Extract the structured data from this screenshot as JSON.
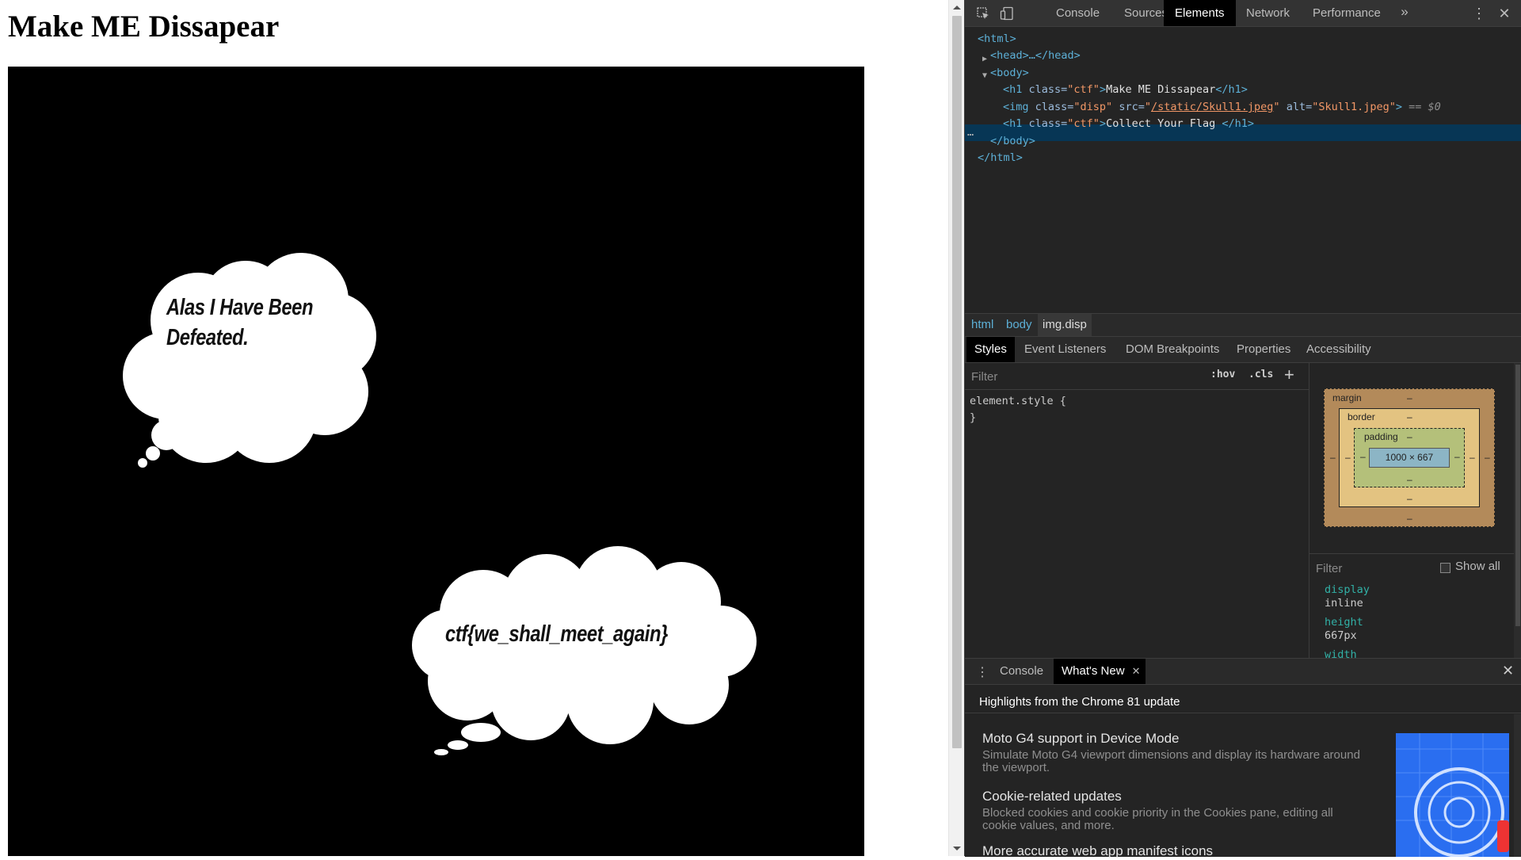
{
  "page": {
    "heading": "Make ME Dissapear",
    "bubble1_line1": "Alas I Have Been",
    "bubble1_line2": "Defeated.",
    "bubble2_text": "ctf{we_shall_meet_again}"
  },
  "devtools": {
    "tabs": [
      "Console",
      "Sources",
      "Elements",
      "Network",
      "Performance"
    ],
    "active_tab": "Elements",
    "more_tabs": "»",
    "dom": {
      "html_open": "<html>",
      "head": "<head>…</head>",
      "body_open": "<body>",
      "h1_tag_open": "<h1 ",
      "h1_attr": "class=",
      "h1_attr_val": "\"ctf\"",
      "h1_text": "Make ME Dissapear",
      "h1_close": "</h1>",
      "img_open": "<img ",
      "img_class_attr": "class=",
      "img_class_val": "\"disp\"",
      "img_src_attr": " src=",
      "img_src_q1": "\"",
      "img_src_val": "/static/Skull1.jpeg",
      "img_src_q2": "\"",
      "img_alt_attr": " alt=",
      "img_alt_val": "\"Skull1.jpeg\"",
      "img_close": ">",
      "img_eq": " == $0",
      "h1b_text": "Collect Your Flag ",
      "body_close": "</body>",
      "html_close": "</html>",
      "dots": "…"
    },
    "breadcrumbs": [
      "html",
      "body",
      "img.disp"
    ],
    "subtabs": [
      "Styles",
      "Event Listeners",
      "DOM Breakpoints",
      "Properties",
      "Accessibility"
    ],
    "styles": {
      "filter_placeholder": "Filter",
      "hov": ":hov",
      "cls": ".cls",
      "add": "+",
      "rule": "element.style {\n}"
    },
    "box_model": {
      "margin_label": "margin",
      "border_label": "border",
      "padding_label": "padding",
      "content_size": "1000 × 667",
      "dash": "–"
    },
    "computed": {
      "filter_placeholder": "Filter",
      "show_all": "Show all",
      "props": [
        {
          "name": "display",
          "value": "inline"
        },
        {
          "name": "height",
          "value": "667px"
        },
        {
          "name": "width",
          "value": ""
        }
      ]
    },
    "drawer": {
      "tabs": [
        "Console",
        "What's New"
      ],
      "active_tab": "What's New",
      "title": "Highlights from the Chrome 81 update",
      "items": [
        {
          "head": "Moto G4 support in Device Mode",
          "body": "Simulate Moto G4 viewport dimensions and display its hardware around the viewport."
        },
        {
          "head": "Cookie-related updates",
          "body": "Blocked cookies and cookie priority in the Cookies pane, editing all cookie values, and more."
        },
        {
          "head": "More accurate web app manifest icons",
          "body": ""
        }
      ]
    }
  },
  "colors": {
    "devtools_bg": "#242424",
    "selected_row": "#073655",
    "tag": "#5db0d7",
    "attr_value": "#f29766"
  }
}
